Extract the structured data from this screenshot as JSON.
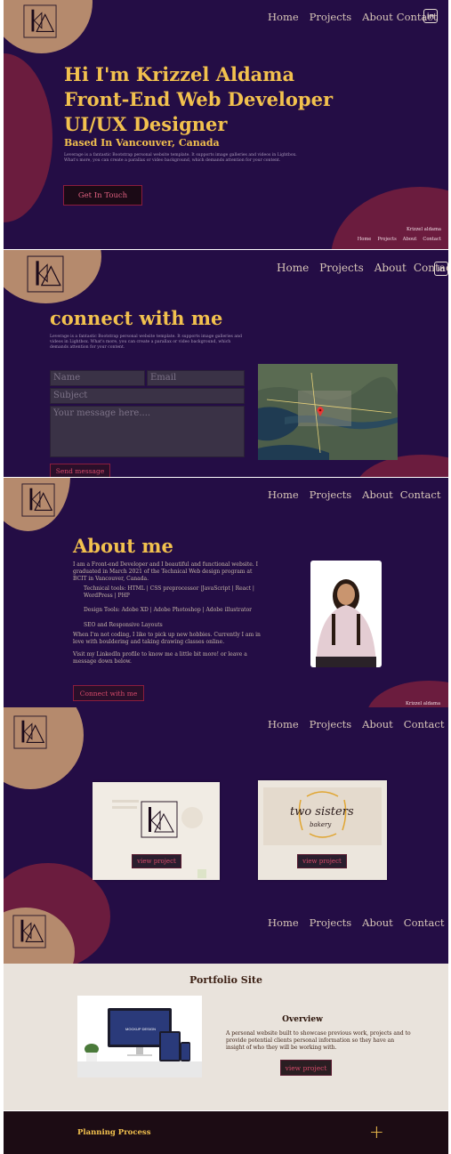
{
  "nav": {
    "home": "Home",
    "projects": "Projects",
    "about": "About",
    "contact": "Contact",
    "linkedin": "in"
  },
  "logo_icon": "krizzel-logo-icon",
  "hero": {
    "line1": "Hi I'm Krizzel Aldama",
    "line2": "Front-End Web Developer",
    "line3": "UI/UX Designer",
    "sub": "Based In Vancouver, Canada",
    "desc": "Leverage is a fantastic Bootstrap personal website template. It supports image galleries and videos in Lightbox. What's more, you can create a parallax or video background, which demands attention for your content.",
    "button": "Get In Touch"
  },
  "footer_mini": {
    "name": "Krizzel aldama",
    "links": [
      "Home",
      "Projects",
      "About",
      "Contact"
    ]
  },
  "contact": {
    "title": "connect with me",
    "desc": "Leverage is a fantastic Bootstrap personal website template. It supports image galleries and videos in Lightbox. What's more, you can create a parallax or video background, which demands attention for your content.",
    "name_placeholder": "Name",
    "email_placeholder": "Email",
    "subject_placeholder": "Subject",
    "message_placeholder": "Your message here....",
    "send": "Send message"
  },
  "about": {
    "title": "About me",
    "p1": "I am a Front-end Developer and I beautiful and functional website. I graduated in March 2021 of the Technical Web design program at BCIT in Vancouver, Canada.",
    "tech": "Technical tools: HTML  |  CSS preprocessor  |JavaScript  |  React  |  WordPress  |  PHP",
    "design": "Design Tools: Adobe XD  |  Adobe Photoshop  |  Adobe illustrator",
    "seo": "SEO and Responsive Layouts",
    "p2": "When I'm not coding, I like to pick up new hobbies. Currently I am in love with bouldering and taking drawing classes online.",
    "p3": "Visit my LinkedIn profile to know me a little bit more! or leave a message down below.",
    "button": "Connect with me",
    "footer_name": "Krizzel aldama"
  },
  "projects": {
    "view1": "view project",
    "view2": "view project",
    "card2_script": "two sisters",
    "card2_sub": "bakery"
  },
  "portfolio": {
    "title": "Portfolio Site",
    "overview_title": "Overview",
    "overview_text": "A personal website built to showcase previous work, projects  and to provide potential clients personal information so they have an insight of who they will be working with.",
    "button": "view project",
    "screen_text": "MOCKUP DESIGN"
  },
  "planning": {
    "title": "Planning Process",
    "toggle": "+"
  }
}
